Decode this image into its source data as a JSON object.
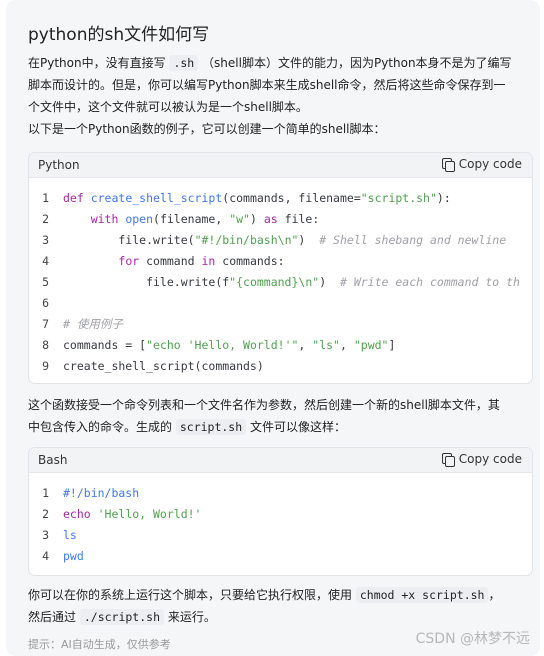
{
  "title": "python的sh文件如何写",
  "intro": {
    "line1_a": "在Python中，没有直接写",
    "line1_code": ".sh",
    "line1_b": "（shell脚本）文件的能力，因为Python本身不是为了编写",
    "line2": "脚本而设计的。但是，你可以编写Python脚本来生成shell命令，然后将这些命令保存到一",
    "line3": "个文件中，这个文件就可以被认为是一个shell脚本。",
    "line4": "以下是一个Python函数的例子，它可以创建一个简单的shell脚本："
  },
  "python_block": {
    "language": "Python",
    "copy_label": "Copy code",
    "line_numbers": [
      "1",
      "2",
      "3",
      "4",
      "5",
      "6",
      "7",
      "8",
      "9"
    ],
    "lines": [
      [
        [
          "kw",
          "def "
        ],
        [
          "fn",
          "create_shell_script"
        ],
        [
          "pl",
          "(commands, filename="
        ],
        [
          "st",
          "\"script.sh\""
        ],
        [
          "pl",
          "):"
        ]
      ],
      [
        [
          "pl",
          "    "
        ],
        [
          "kw",
          "with "
        ],
        [
          "fn",
          "open"
        ],
        [
          "pl",
          "(filename, "
        ],
        [
          "st",
          "\"w\""
        ],
        [
          "pl",
          ") "
        ],
        [
          "kw",
          "as "
        ],
        [
          "pl",
          "file:"
        ]
      ],
      [
        [
          "pl",
          "        file.write("
        ],
        [
          "st",
          "\"#!/bin/bash\\n\""
        ],
        [
          "pl",
          ")  "
        ],
        [
          "cm",
          "# Shell shebang and newline"
        ]
      ],
      [
        [
          "pl",
          "        "
        ],
        [
          "kw",
          "for "
        ],
        [
          "pl",
          "command "
        ],
        [
          "kw",
          "in "
        ],
        [
          "pl",
          "commands:"
        ]
      ],
      [
        [
          "pl",
          "            file.write(f"
        ],
        [
          "st",
          "\"{command}\\n\""
        ],
        [
          "pl",
          ")  "
        ],
        [
          "cm",
          "# Write each command to th"
        ]
      ],
      [],
      [
        [
          "cm",
          "# 使用例子"
        ]
      ],
      [
        [
          "pl",
          "commands = ["
        ],
        [
          "st",
          "\"echo 'Hello, World!'\""
        ],
        [
          "pl",
          ", "
        ],
        [
          "st",
          "\"ls\""
        ],
        [
          "pl",
          ", "
        ],
        [
          "st",
          "\"pwd\""
        ],
        [
          "pl",
          "]"
        ]
      ],
      [
        [
          "pl",
          "create_shell_script(commands)"
        ]
      ]
    ]
  },
  "middle": {
    "line1": "这个函数接受一个命令列表和一个文件名作为参数，然后创建一个新的shell脚本文件，其",
    "line2_a": "中包含传入的命令。生成的",
    "line2_code": "script.sh",
    "line2_b": "文件可以像这样："
  },
  "bash_block": {
    "language": "Bash",
    "copy_label": "Copy code",
    "line_numbers": [
      "1",
      "2",
      "3",
      "4"
    ],
    "lines": [
      [
        [
          "fn",
          "#!/bin/bash"
        ]
      ],
      [
        [
          "kw",
          "echo "
        ],
        [
          "st",
          "'Hello, World!'"
        ]
      ],
      [
        [
          "fn",
          "ls"
        ]
      ],
      [
        [
          "fn",
          "pwd"
        ]
      ]
    ]
  },
  "closing": {
    "line1_a": "你可以在你的系统上运行这个脚本，只要给它执行权限，使用",
    "line1_code": "chmod +x script.sh",
    "line1_b": "，",
    "line2_a": "然后通过",
    "line2_code": "./script.sh",
    "line2_b": "来运行。"
  },
  "note": "提示：AI自动生成，仅供参考",
  "watermark": "CSDN @林梦不远"
}
